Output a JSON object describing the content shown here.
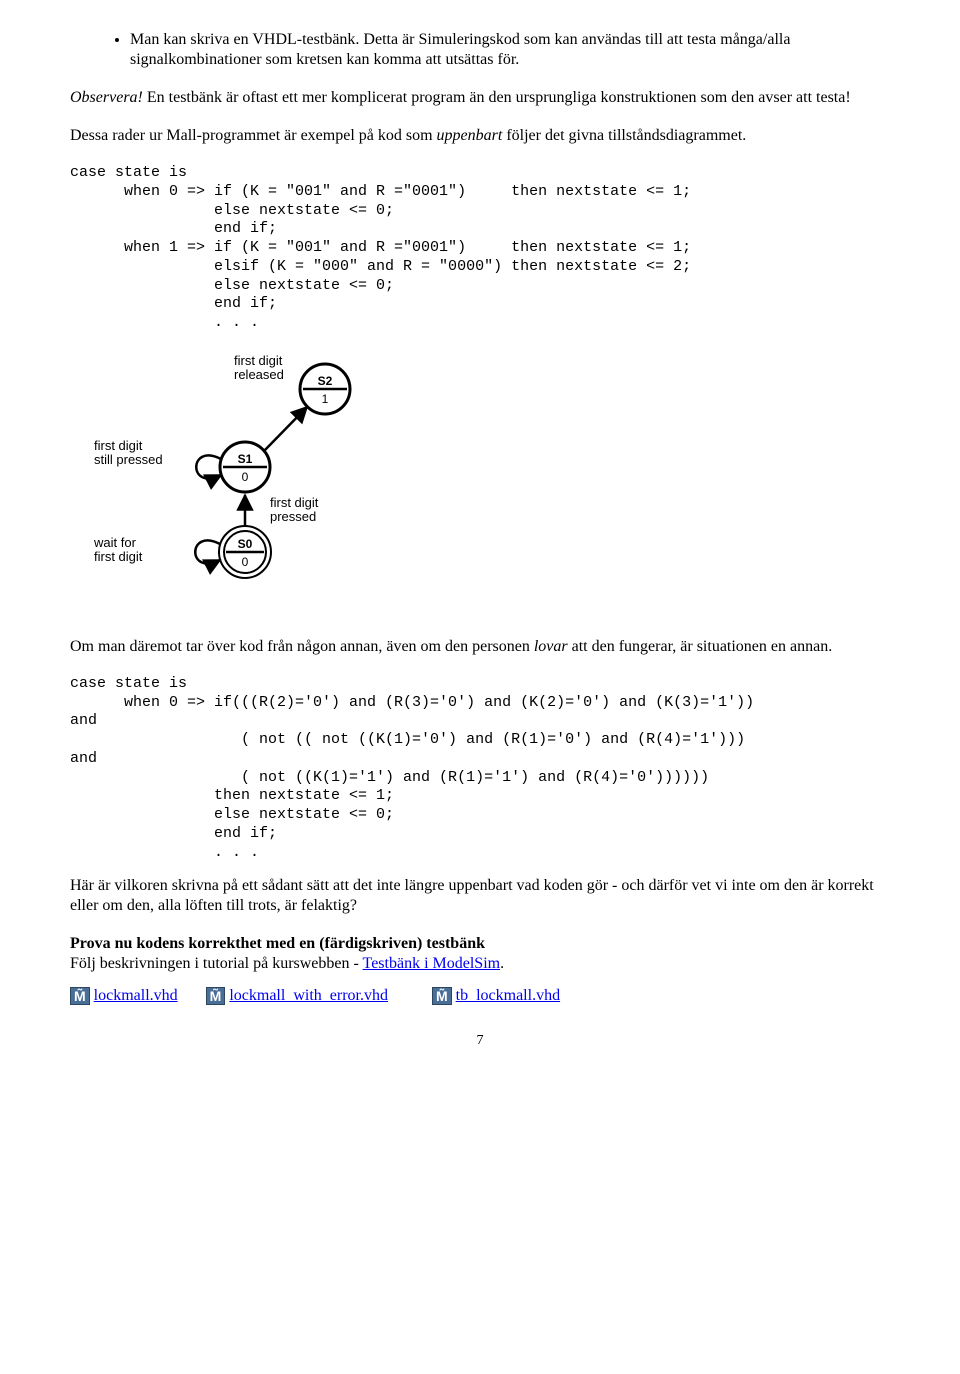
{
  "bullet": {
    "text": "Man kan skriva en VHDL-testbänk. Detta är Simuleringskod som kan användas till att testa många/alla signalkombinationer som kretsen kan komma att utsättas för."
  },
  "observera": {
    "prefix": "Observera!",
    "text": " En testbänk är oftast ett mer komplicerat program än den ursprungliga konstruktionen som den avser att testa!"
  },
  "follow": {
    "p1a": "Dessa rader ur Mall-programmet är exempel på kod som ",
    "p1i": "uppenbart",
    "p1b": " följer det givna tillståndsdiagrammet."
  },
  "code1": "case state is\n      when 0 => if (K = \"001\" and R =\"0001\")     then nextstate <= 1;\n                else nextstate <= 0;\n                end if;\n      when 1 => if (K = \"001\" and R =\"0001\")     then nextstate <= 1;\n                elsif (K = \"000\" and R = \"0000\") then nextstate <= 2;\n                else nextstate <= 0;\n                end if;\n                . . .",
  "diagram": {
    "labels": {
      "first_digit_released": "first digit\nreleased",
      "first_digit_still_pressed": "first digit\nstill pressed",
      "first_digit_pressed": "first digit\npressed",
      "wait_for_first_digit": "wait for\nfirst digit",
      "s0": "S0",
      "s1": "S1",
      "s2": "S2",
      "o0": "0",
      "o1": "0",
      "o2": "1"
    }
  },
  "mid": {
    "a": "Om man däremot tar över kod från någon annan, även om den personen ",
    "i": "lovar",
    "b": " att den fungerar, är situationen en annan."
  },
  "code2": "case state is\n      when 0 => if(((R(2)='0') and (R(3)='0') and (K(2)='0') and (K(3)='1'))\nand\n                   ( not (( not ((K(1)='0') and (R(1)='0') and (R(4)='1')))\nand\n                   ( not ((K(1)='1') and (R(1)='1') and (R(4)='0'))))))\n                then nextstate <= 1;\n                else nextstate <= 0;\n                end if;\n                . . .",
  "bottom": {
    "p1": "Här är vilkoren skrivna på ett sådant sätt att det inte längre uppenbart vad koden gör - och därför vet vi inte om den är korrekt eller om den, alla löften till trots, är felaktig?",
    "bold": "Prova nu kodens korrekthet med en (färdigskriven) testbänk",
    "p2a": "Följ beskrivningen i tutorial på kurswebben - ",
    "link": "Testbänk i ModelSim",
    "p2b": "."
  },
  "files": {
    "f1": "lockmall.vhd",
    "f2": "lockmall_with_error.vhd",
    "f3": "tb_lockmall.vhd",
    "icon_char": "M̃"
  },
  "page": "7"
}
